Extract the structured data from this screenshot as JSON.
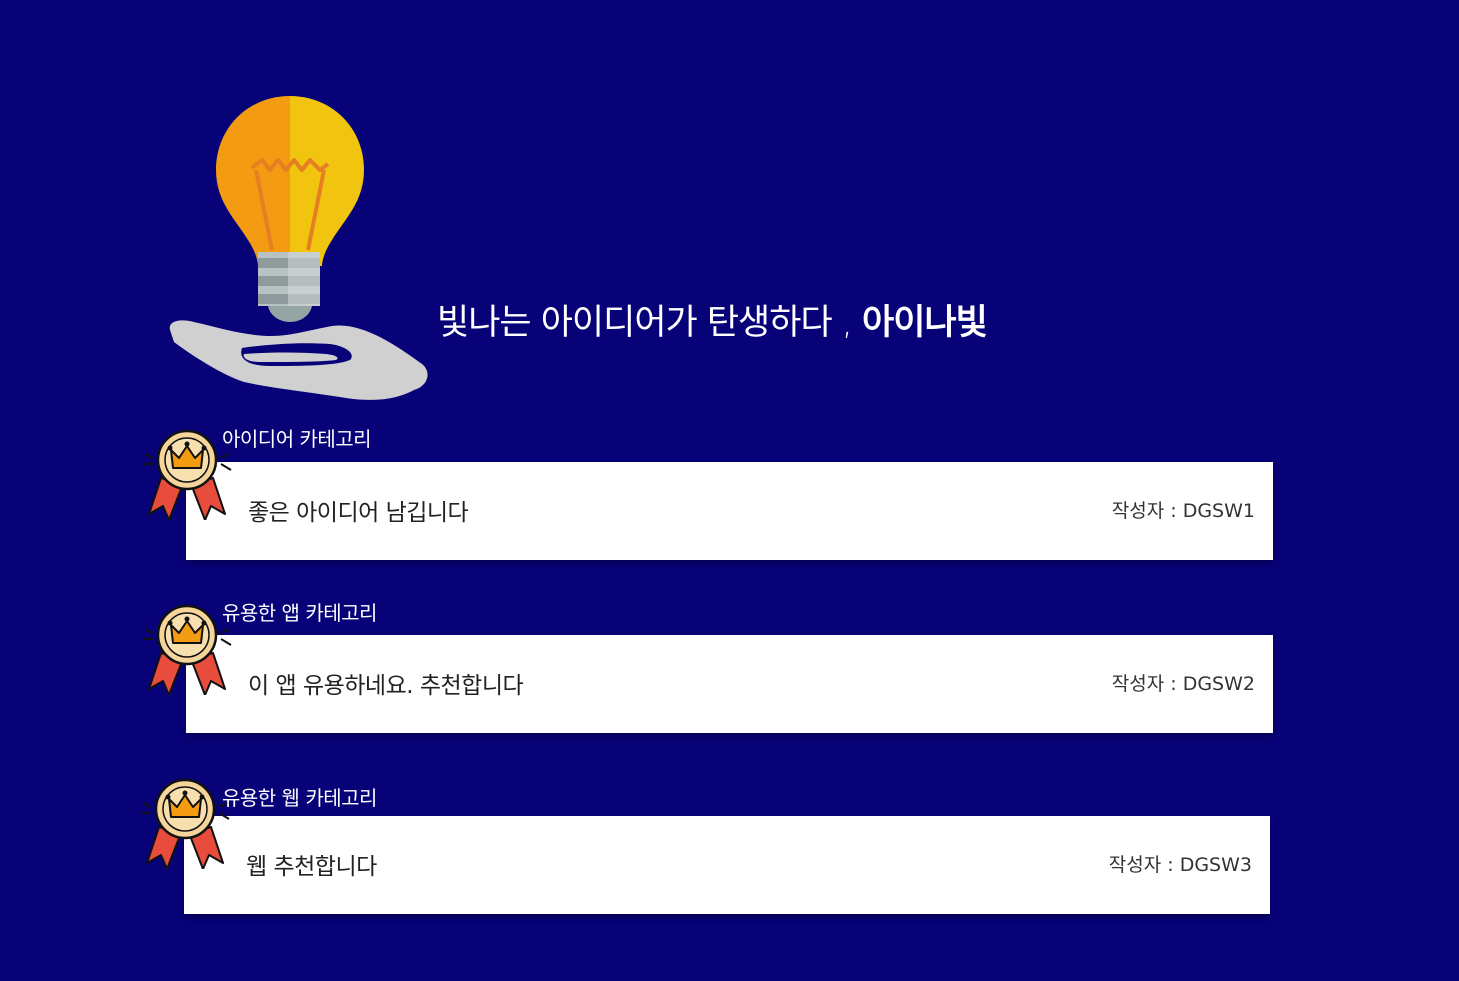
{
  "hero": {
    "title_prefix": "빛나는 아이디어가 탄생하다 , ",
    "brand": "아이나빛",
    "icon": "lightbulb-hand-icon"
  },
  "posts": [
    {
      "category": "아이디어 카테고리",
      "text": "좋은 아이디어 남깁니다",
      "author_label": "작성자 : DGSW1",
      "icon": "medal-crown-icon"
    },
    {
      "category": "유용한 앱  카테고리",
      "text": "이 앱 유용하네요. 추천합니다",
      "author_label": "작성자 : DGSW2",
      "icon": "medal-crown-icon"
    },
    {
      "category": "유용한 웹  카테고리",
      "text": "웹 추천합니다",
      "author_label": "작성자 : DGSW3",
      "icon": "medal-crown-icon"
    }
  ],
  "colors": {
    "background": "#070277",
    "card": "#ffffff",
    "bulb_left": "#f39c12",
    "bulb_right": "#f1c40f",
    "medal_gold": "#f6d59a",
    "ribbon": "#e74c3c"
  }
}
